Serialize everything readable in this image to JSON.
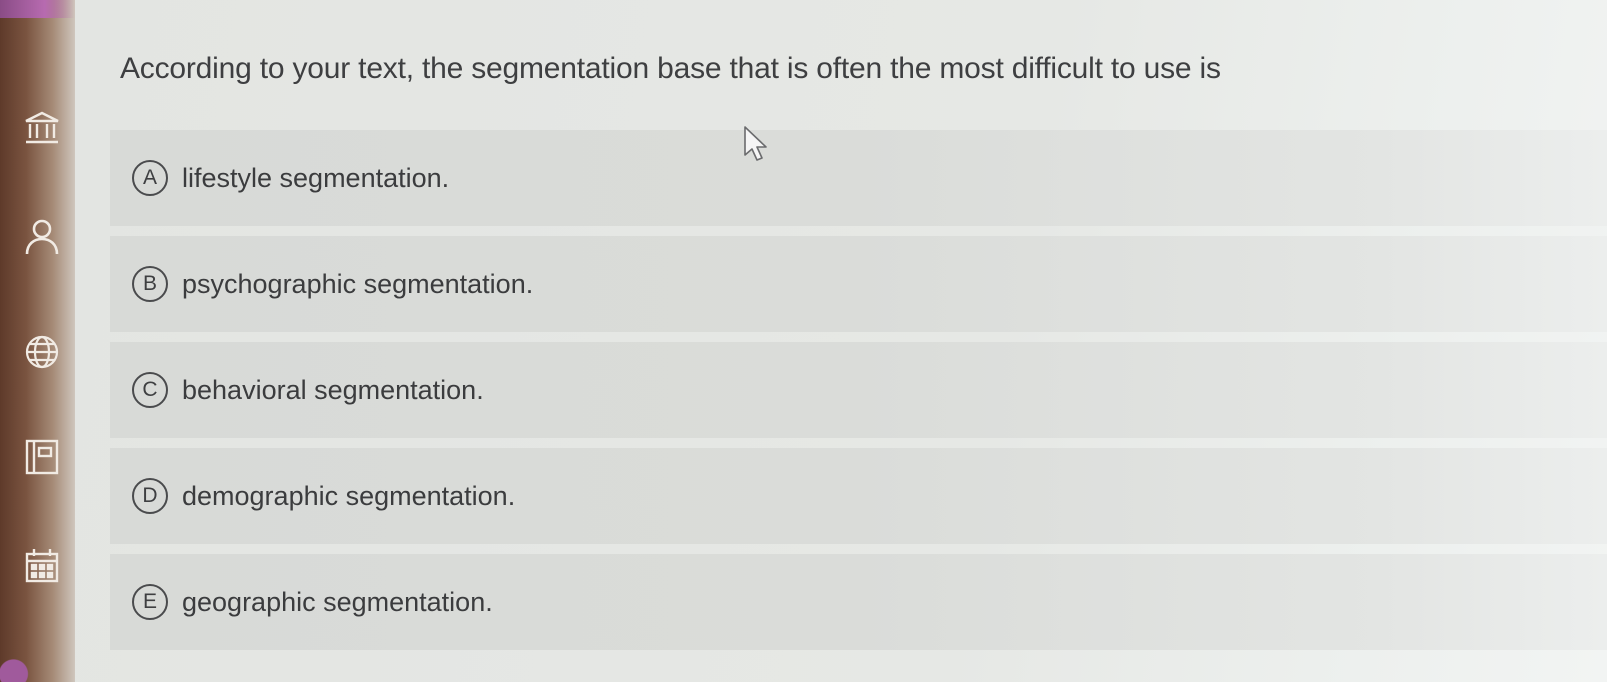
{
  "sidebar": {
    "icons": [
      "bank-icon",
      "user-icon",
      "globe-icon",
      "book-icon",
      "calendar-icon"
    ]
  },
  "question": {
    "text": "According to your text, the segmentation base that is often the most difficult to use is"
  },
  "options": [
    {
      "letter": "A",
      "text": "lifestyle segmentation."
    },
    {
      "letter": "B",
      "text": "psychographic segmentation."
    },
    {
      "letter": "C",
      "text": "behavioral segmentation."
    },
    {
      "letter": "D",
      "text": "demographic segmentation."
    },
    {
      "letter": "E",
      "text": "geographic segmentation."
    }
  ]
}
